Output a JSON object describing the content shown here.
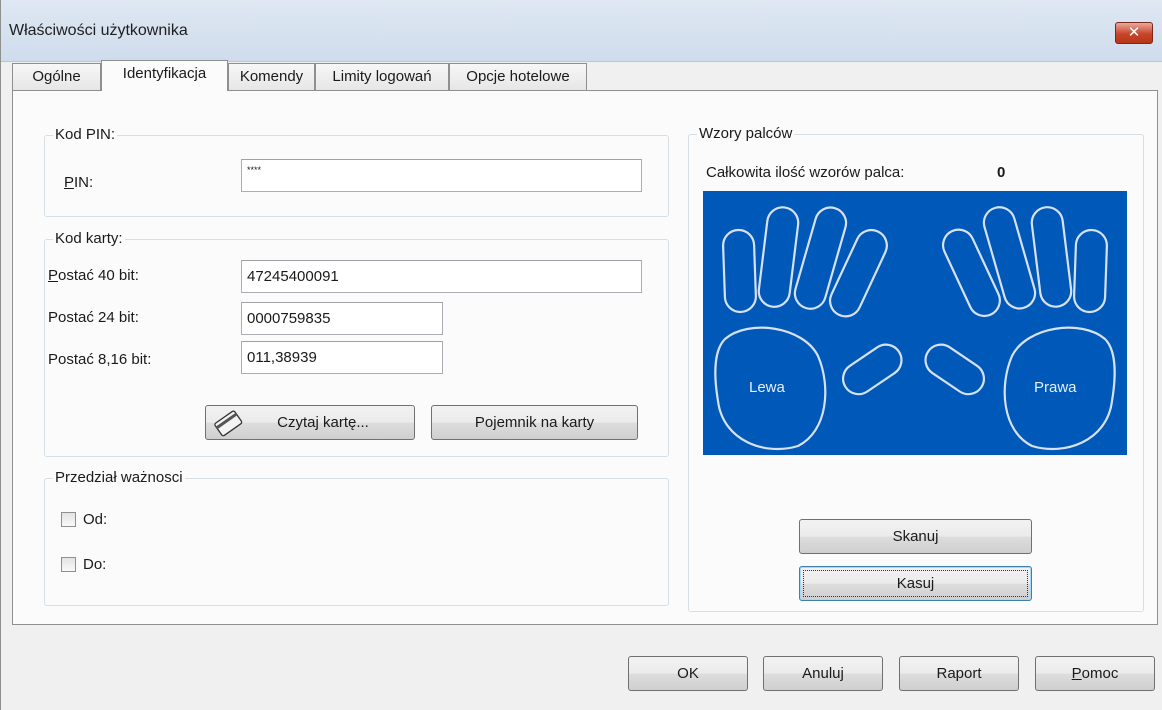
{
  "window": {
    "title": "Właściwości użytkownika",
    "close_glyph": "✕"
  },
  "tabs": [
    {
      "label": "Ogólne"
    },
    {
      "label": "Identyfikacja"
    },
    {
      "label": "Komendy"
    },
    {
      "label": "Limity logowań"
    },
    {
      "label": "Opcje hotelowe"
    }
  ],
  "pin": {
    "group_title": "Kod PIN:",
    "label_first": "P",
    "label_rest": "IN:",
    "value": "****"
  },
  "card": {
    "group_title": "Kod karty:",
    "f40_label_first": "P",
    "f40_label_rest": "ostać 40 bit:",
    "f40_value": "47245400091",
    "f24_label": "Postać 24 bit:",
    "f24_value": "0000759835",
    "f816_label": "Postać 8,16 bit:",
    "f816_value": "011,38939",
    "read_button": "Czytaj kartę...",
    "read_icon": "card-icon",
    "container_button": "Pojemnik na karty"
  },
  "validity": {
    "group_title": "Przedział ważnosci",
    "from_label": "Od:",
    "to_label": "Do:",
    "from_checked": false,
    "to_checked": false
  },
  "fingers": {
    "group_title": "Wzory palców",
    "count_label": "Całkowita ilość wzorów palca:",
    "count_value": "0",
    "left_label": "Lewa",
    "right_label": "Prawa",
    "scan_button": "Skanuj",
    "delete_button": "Kasuj",
    "hand_bg": "#0058b8",
    "hand_outline": "#d6e2f2"
  },
  "footer": {
    "ok": "OK",
    "cancel": "Anuluj",
    "report": "Raport",
    "help_first": "P",
    "help_rest": "omoc"
  }
}
